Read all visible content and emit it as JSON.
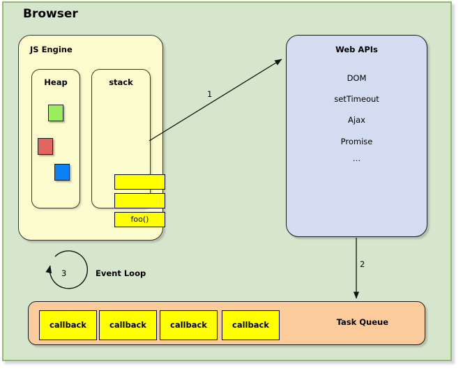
{
  "diagram": {
    "title": "Browser",
    "js_engine": {
      "title": "JS Engine",
      "heap": {
        "title": "Heap",
        "blocks": [
          {
            "name": "heap-block-green",
            "color": "#9bee5e"
          },
          {
            "name": "heap-block-red",
            "color": "#e2655f"
          },
          {
            "name": "heap-block-blue",
            "color": "#0b81f5"
          }
        ]
      },
      "stack": {
        "title": "stack",
        "frames": [
          {
            "label": ""
          },
          {
            "label": ""
          },
          {
            "label": "foo()"
          }
        ]
      }
    },
    "web_apis": {
      "title": "Web APIs",
      "items": [
        "DOM",
        "setTimeout",
        "Ajax",
        "Promise",
        "…"
      ]
    },
    "task_queue": {
      "title": "Task Queue",
      "callbacks": [
        "callback",
        "callback",
        "callback",
        "callback"
      ]
    },
    "event_loop": {
      "label": "Event Loop",
      "step": "3"
    },
    "arrows": [
      {
        "name": "stack-to-webapis-arrow",
        "label": "1"
      },
      {
        "name": "webapis-to-taskqueue-arrow",
        "label": "2"
      }
    ],
    "colors": {
      "browser_fill": "#d6e6cd",
      "browser_border": "#8fbc6f",
      "js_engine_fill": "#fcfbcd",
      "web_apis_fill": "#d3dcf0",
      "task_queue_fill": "#fbcb9c",
      "box_yellow": "#ffff00"
    }
  }
}
